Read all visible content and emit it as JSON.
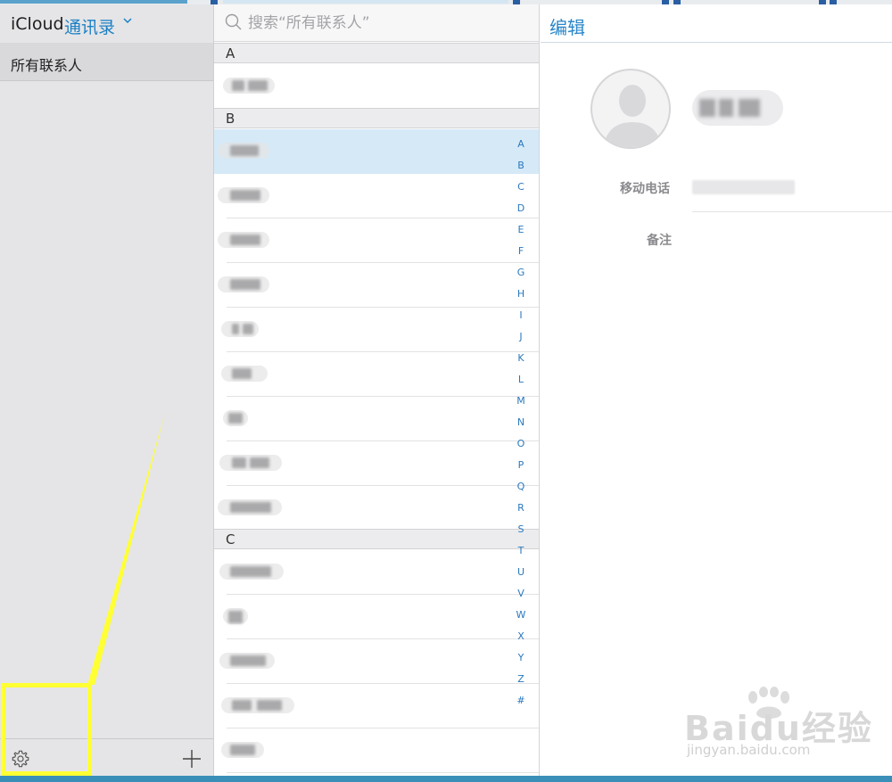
{
  "sidebar": {
    "brand": "iCloud",
    "app_name": "通讯录",
    "groups": [
      {
        "label": "所有联系人"
      }
    ]
  },
  "list": {
    "search_placeholder": "搜索“所有联系人”",
    "sections": [
      {
        "letter": "A",
        "rows": 1
      },
      {
        "letter": "B",
        "rows": 9
      },
      {
        "letter": "C",
        "rows": 5
      }
    ],
    "index_letters": [
      "A",
      "B",
      "C",
      "D",
      "E",
      "F",
      "G",
      "H",
      "I",
      "J",
      "K",
      "L",
      "M",
      "N",
      "O",
      "P",
      "Q",
      "R",
      "S",
      "T",
      "U",
      "V",
      "W",
      "X",
      "Y",
      "Z",
      "#"
    ]
  },
  "detail": {
    "edit_label": "编辑",
    "fields": [
      {
        "label": "移动电话"
      },
      {
        "label": "备注"
      }
    ]
  },
  "watermark": {
    "brand": "Baidu经验",
    "url": "jingyan.baidu.com"
  },
  "colors": {
    "accent": "#1b7fc4",
    "selected_row": "#d5e9f7",
    "highlight": "#ffff33"
  }
}
